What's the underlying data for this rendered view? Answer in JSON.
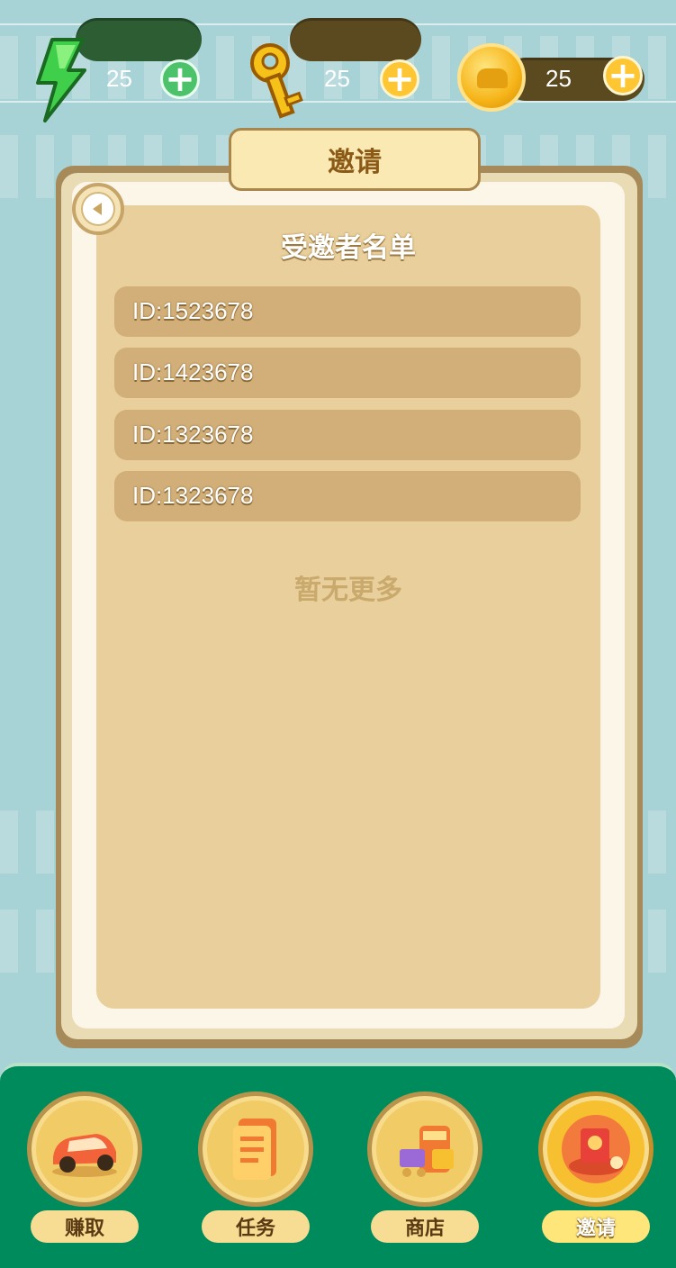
{
  "resources": {
    "energy": {
      "icon": "lightning-bolt-icon",
      "value": "25"
    },
    "keys": {
      "icon": "key-icon",
      "value": "25"
    },
    "coins": {
      "icon": "car-coin-icon",
      "value": "25"
    }
  },
  "panel": {
    "tab_label": "邀请",
    "list_title": "受邀者名单",
    "invitees": [
      "ID:1523678",
      "ID:1423678",
      "ID:1323678",
      "ID:1323678"
    ],
    "empty_note": "暂无更多"
  },
  "bottom_nav": {
    "items": [
      {
        "label": "赚取",
        "icon": "car-icon"
      },
      {
        "label": "任务",
        "icon": "task-list-icon"
      },
      {
        "label": "商店",
        "icon": "shop-icon"
      },
      {
        "label": "邀请",
        "icon": "red-envelope-icon"
      }
    ],
    "active": "邀请"
  },
  "colors": {
    "background": "#a8d3d6",
    "panel": "#e8cf9b",
    "row": "#d2af78",
    "nav": "#008b5c"
  }
}
